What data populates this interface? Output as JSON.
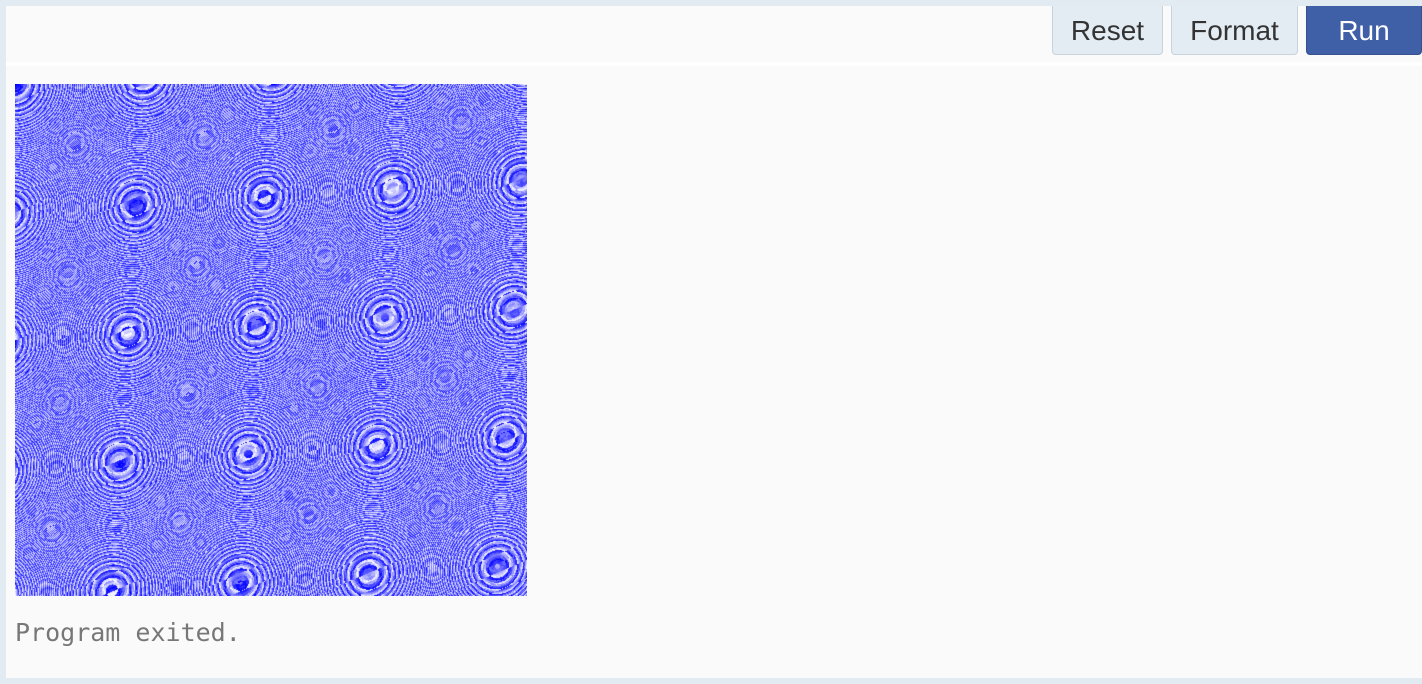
{
  "toolbar": {
    "reset_label": "Reset",
    "format_label": "Format",
    "run_label": "Run"
  },
  "output": {
    "image_description": "generated pattern image",
    "pattern_colors": [
      "#0000ff",
      "#ffffff"
    ],
    "status_text": "Program exited."
  }
}
